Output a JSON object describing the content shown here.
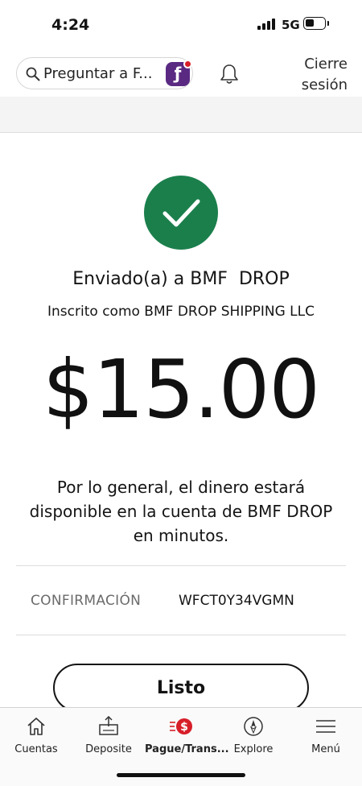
{
  "status_bar": {
    "time": "4:24",
    "network": "5G"
  },
  "header": {
    "search_placeholder": "Preguntar a F...",
    "logout_label": "Cierre\nsesión"
  },
  "confirmation": {
    "sent_to": "Enviado(a) a BMF  DROP",
    "enrolled_as": "Inscrito como BMF DROP SHIPPING LLC",
    "amount": "$15.00",
    "availability_message": "Por lo general, el dinero estará\ndisponible en la cuenta de BMF  DROP\nen minutos.",
    "confirmation_label": "CONFIRMACIÓN",
    "confirmation_number": "WFCT0Y34VGMN",
    "done_label": "Listo"
  },
  "bottom_nav": {
    "items": [
      {
        "label": "Cuentas",
        "icon": "home-icon"
      },
      {
        "label": "Deposite",
        "icon": "deposit-icon"
      },
      {
        "label": "Pague/Trans...",
        "icon": "pay-transfer-icon",
        "active": true
      },
      {
        "label": "Explore",
        "icon": "compass-icon"
      },
      {
        "label": "Menú",
        "icon": "menu-icon"
      }
    ]
  },
  "colors": {
    "success_green": "#1b7f4c",
    "brand_red": "#d71e28",
    "assistant_purple": "#5a2a82"
  }
}
